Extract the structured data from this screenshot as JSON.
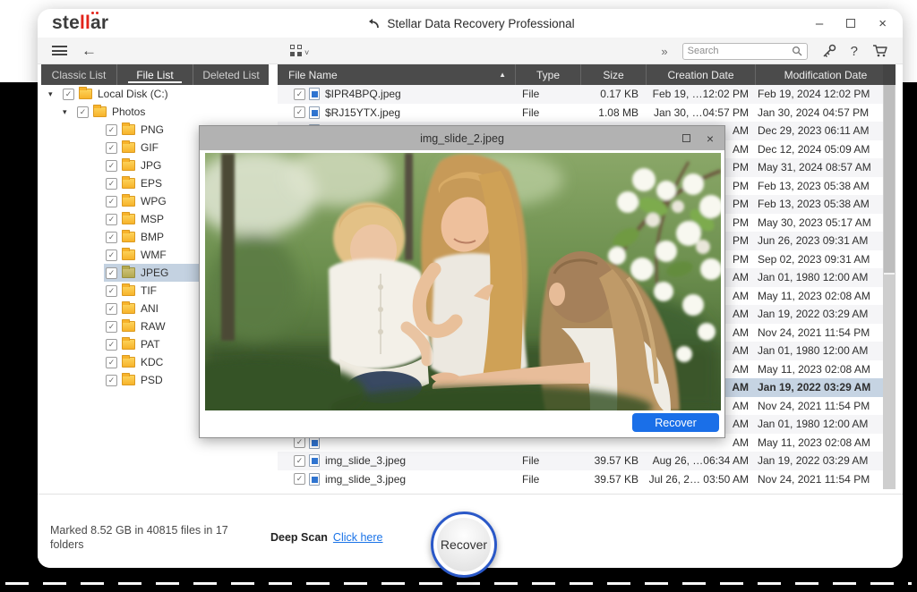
{
  "window": {
    "title": "Stellar Data Recovery Professional",
    "logo": {
      "pre": "ste",
      "mid": "ll",
      "post": "ar"
    },
    "controls": {
      "minimize": "–",
      "close": "×"
    }
  },
  "toolbar": {
    "overflow_glyph": "»",
    "search_placeholder": "Search",
    "help_glyph": "?"
  },
  "tabs": [
    {
      "label": "Classic List"
    },
    {
      "label": "File List"
    },
    {
      "label": "Deleted List"
    }
  ],
  "tree": {
    "items": [
      {
        "label": "Local Disk (C:)",
        "level": 0,
        "expand": true
      },
      {
        "label": "Photos",
        "level": 1,
        "expand": true
      },
      {
        "label": "PNG",
        "level": 2
      },
      {
        "label": "GIF",
        "level": 2
      },
      {
        "label": "JPG",
        "level": 2
      },
      {
        "label": "EPS",
        "level": 2
      },
      {
        "label": "WPG",
        "level": 2
      },
      {
        "label": "MSP",
        "level": 2
      },
      {
        "label": "BMP",
        "level": 2
      },
      {
        "label": "WMF",
        "level": 2
      },
      {
        "label": "JPEG",
        "level": 2,
        "selected": true
      },
      {
        "label": "TIF",
        "level": 2
      },
      {
        "label": "ANI",
        "level": 2
      },
      {
        "label": "RAW",
        "level": 2
      },
      {
        "label": "PAT",
        "level": 2
      },
      {
        "label": "KDC",
        "level": 2
      },
      {
        "label": "PSD",
        "level": 2
      }
    ],
    "check_glyph": "✓",
    "arrow_glyph": "▾"
  },
  "list": {
    "columns": {
      "name": "File Name",
      "type": "Type",
      "size": "Size",
      "creation": "Creation Date",
      "modification": "Modification Date"
    },
    "sort_glyph": "▲",
    "rows": [
      {
        "name": "$IPR4BPQ.jpeg",
        "type": "File",
        "size": "0.17 KB",
        "creation": "Feb 19, …12:02 PM",
        "modification": "Feb 19, 2024 12:02 PM"
      },
      {
        "name": "$RJ15YTX.jpeg",
        "type": "File",
        "size": "1.08 MB",
        "creation": "Jan 30, …04:57 PM",
        "modification": "Jan 30, 2024 04:57 PM"
      },
      {
        "name": "",
        "type": "",
        "size": "",
        "creation": "AM",
        "modification": "Dec 29, 2023 06:11 AM"
      },
      {
        "name": "",
        "type": "",
        "size": "",
        "creation": "AM",
        "modification": "Dec 12, 2024 05:09 AM"
      },
      {
        "name": "",
        "type": "",
        "size": "",
        "creation": "PM",
        "modification": "May 31, 2024 08:57 AM"
      },
      {
        "name": "",
        "type": "",
        "size": "",
        "creation": "PM",
        "modification": "Feb 13, 2023 05:38 AM"
      },
      {
        "name": "",
        "type": "",
        "size": "",
        "creation": "PM",
        "modification": "Feb 13, 2023 05:38 AM"
      },
      {
        "name": "",
        "type": "",
        "size": "",
        "creation": "PM",
        "modification": "May 30, 2023 05:17 AM"
      },
      {
        "name": "",
        "type": "",
        "size": "",
        "creation": "PM",
        "modification": "Jun 26, 2023 09:31 AM"
      },
      {
        "name": "",
        "type": "",
        "size": "",
        "creation": "PM",
        "modification": "Sep 02, 2023 09:31 AM"
      },
      {
        "name": "",
        "type": "",
        "size": "",
        "creation": "AM",
        "modification": "Jan 01, 1980 12:00 AM"
      },
      {
        "name": "",
        "type": "",
        "size": "",
        "creation": "AM",
        "modification": "May 11, 2023 02:08 AM"
      },
      {
        "name": "",
        "type": "",
        "size": "",
        "creation": "AM",
        "modification": "Jan 19, 2022 03:29 AM"
      },
      {
        "name": "",
        "type": "",
        "size": "",
        "creation": "AM",
        "modification": "Nov 24, 2021 11:54 PM"
      },
      {
        "name": "",
        "type": "",
        "size": "",
        "creation": "AM",
        "modification": "Jan 01, 1980 12:00 AM"
      },
      {
        "name": "",
        "type": "",
        "size": "",
        "creation": "AM",
        "modification": "May 11, 2023 02:08 AM"
      },
      {
        "name": "",
        "type": "",
        "size": "",
        "creation": "AM",
        "modification": "Jan 19, 2022 03:29 AM",
        "selected": true
      },
      {
        "name": "",
        "type": "",
        "size": "",
        "creation": "AM",
        "modification": "Nov 24, 2021 11:54 PM"
      },
      {
        "name": "",
        "type": "",
        "size": "",
        "creation": "AM",
        "modification": "Jan 01, 1980 12:00 AM"
      },
      {
        "name": "",
        "type": "",
        "size": "",
        "creation": "AM",
        "modification": "May 11, 2023 02:08 AM"
      },
      {
        "name": "img_slide_3.jpeg",
        "type": "File",
        "size": "39.57 KB",
        "creation": "Aug 26, …06:34 AM",
        "modification": "Jan 19, 2022 03:29 AM"
      },
      {
        "name": "img_slide_3.jpeg",
        "type": "File",
        "size": "39.57 KB",
        "creation": "Jul 26, 2… 03:50 AM",
        "modification": "Nov 24, 2021 11:54 PM"
      }
    ]
  },
  "preview": {
    "title": "img_slide_2.jpeg",
    "recover_label": "Recover",
    "close_glyph": "×"
  },
  "footer": {
    "status": "Marked 8.52 GB in 40815 files in 17 folders",
    "deep_scan_label": "Deep Scan",
    "deep_scan_link": "Click here",
    "recover_label": "Recover"
  }
}
